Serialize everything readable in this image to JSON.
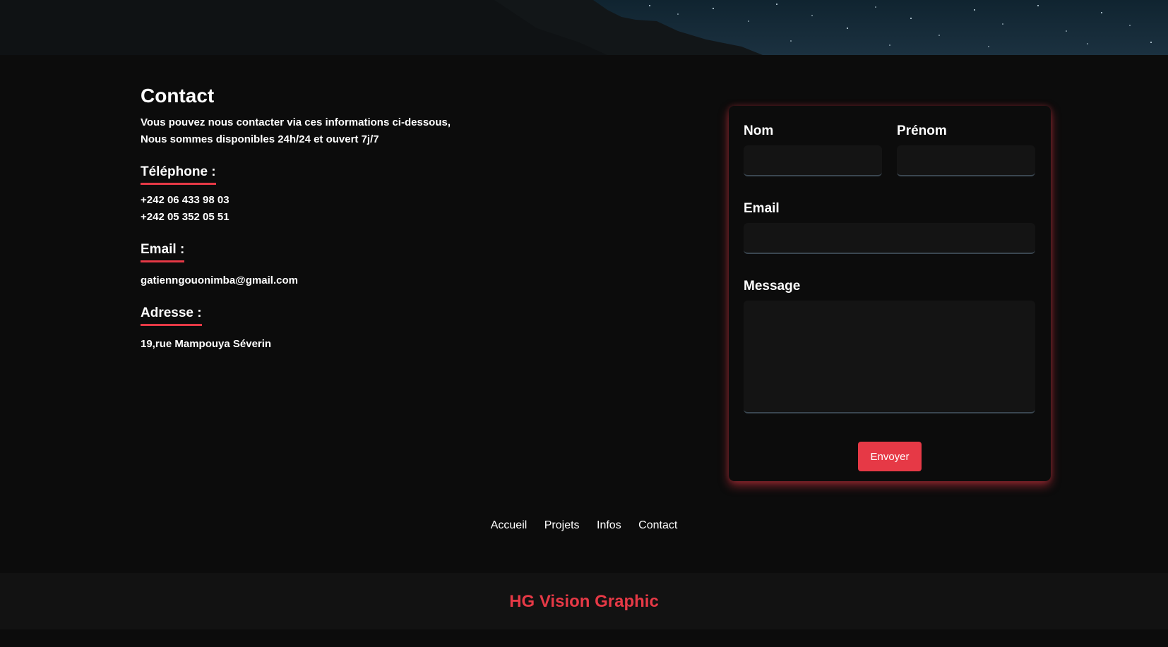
{
  "contact": {
    "title": "Contact",
    "intro_line1": "Vous pouvez nous contacter via ces informations ci-dessous,",
    "intro_line2": "Nous sommes disponibles 24h/24 et ouvert 7j/7",
    "phone_heading": "Téléphone :",
    "phones": [
      "+242 06 433 98 03",
      "+242 05 352 05 51"
    ],
    "email_heading": "Email :",
    "email": "gatienngouonimba@gmail.com",
    "address_heading": "Adresse :",
    "address": "19,rue Mampouya Séverin"
  },
  "form": {
    "nom_label": "Nom",
    "prenom_label": "Prénom",
    "email_label": "Email",
    "message_label": "Message",
    "nom_value": "",
    "prenom_value": "",
    "email_value": "",
    "message_value": "",
    "submit_label": "Envoyer"
  },
  "footer": {
    "nav": [
      "Accueil",
      "Projets",
      "Infos",
      "Contact"
    ],
    "brand": "HG Vision Graphic"
  },
  "colors": {
    "accent": "#e63946",
    "background": "#0c0c0c",
    "footer_bar": "#121212"
  }
}
